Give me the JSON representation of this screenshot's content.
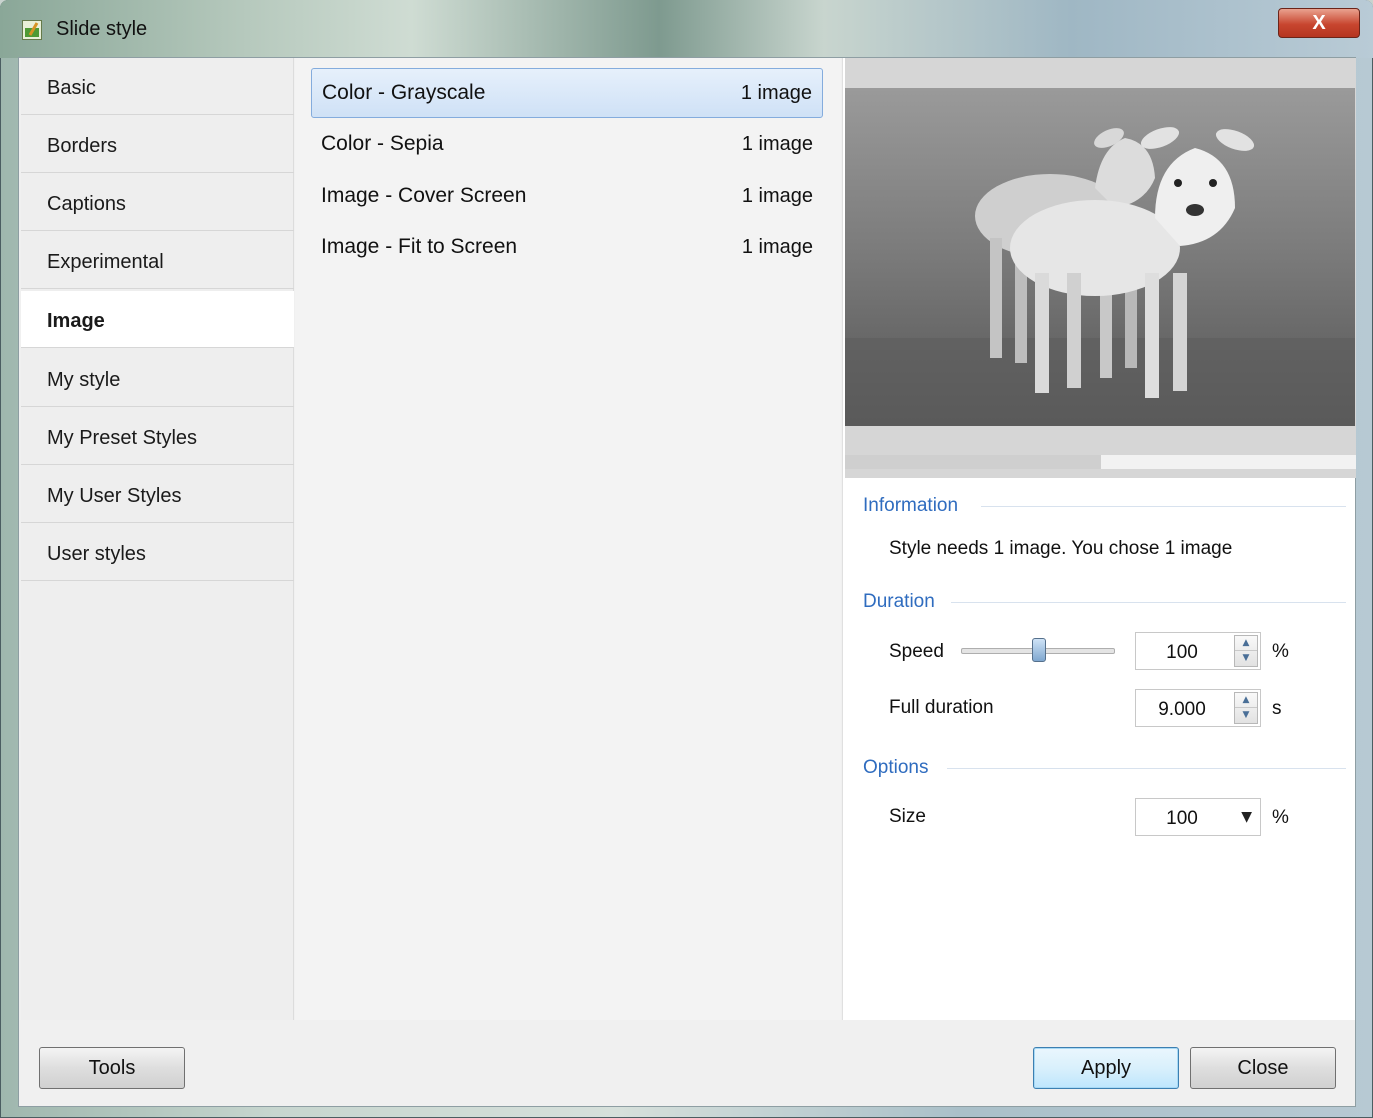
{
  "window": {
    "title": "Slide style",
    "close_glyph": "X",
    "icon": "slide-style-app-icon"
  },
  "sidebar": {
    "items": [
      {
        "label": "Basic"
      },
      {
        "label": "Borders"
      },
      {
        "label": "Captions"
      },
      {
        "label": "Experimental"
      },
      {
        "label": "Image",
        "active": true
      },
      {
        "label": "My style"
      },
      {
        "label": "My Preset Styles"
      },
      {
        "label": "My User Styles"
      },
      {
        "label": "User styles"
      }
    ]
  },
  "styles_list": [
    {
      "name": "Color - Grayscale",
      "count": "1 image",
      "selected": true
    },
    {
      "name": "Color - Sepia",
      "count": "1 image"
    },
    {
      "name": "Image - Cover Screen",
      "count": "1 image"
    },
    {
      "name": "Image - Fit to Screen",
      "count": "1 image"
    }
  ],
  "preview": {
    "image": "grayscale-lambs-photo",
    "playback_progress": 0.5
  },
  "information": {
    "title": "Information",
    "text": "Style needs 1 image. You chose 1 image"
  },
  "duration": {
    "title": "Duration",
    "speed_label": "Speed",
    "speed_value": "100",
    "speed_unit": "%",
    "speed_slider_level": 0.5,
    "full_duration_label": "Full duration",
    "full_duration_value": "9.000",
    "full_duration_unit": "s"
  },
  "options": {
    "title": "Options",
    "size_label": "Size",
    "size_value": "100",
    "size_unit": "%"
  },
  "footer": {
    "tools_label": "Tools",
    "apply_label": "Apply",
    "close_label": "Close"
  },
  "colors": {
    "selection": "#cfe1f6",
    "group_title": "#2f6cbf",
    "close_button": "#c8462f"
  }
}
